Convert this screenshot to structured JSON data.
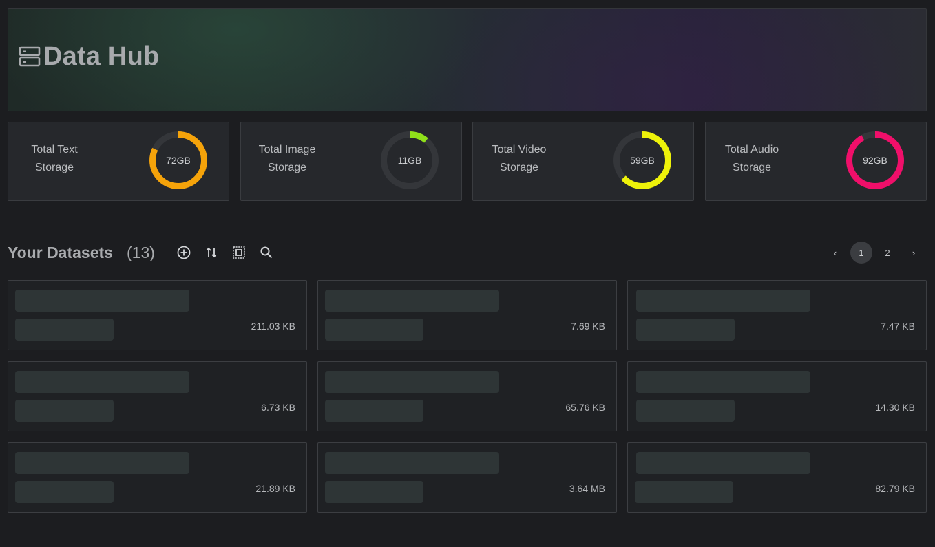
{
  "header": {
    "title": "Data Hub",
    "icon": "server-storage-icon"
  },
  "stats": [
    {
      "label_line1": "Total Text",
      "label_line2": "Storage",
      "value": "72GB",
      "fill_fraction": 0.82,
      "color": "#f5a30a"
    },
    {
      "label_line1": "Total Image",
      "label_line2": "Storage",
      "value": "11GB",
      "fill_fraction": 0.11,
      "color": "#8fe01a"
    },
    {
      "label_line1": "Total Video",
      "label_line2": "Storage",
      "value": "59GB",
      "fill_fraction": 0.63,
      "color": "#eef20a"
    },
    {
      "label_line1": "Total Audio",
      "label_line2": "Storage",
      "value": "92GB",
      "fill_fraction": 0.92,
      "color": "#f00f6a"
    }
  ],
  "datasets": {
    "title": "Your Datasets",
    "count": "(13)",
    "toolbar": {
      "add_icon": "add-circle-icon",
      "sort_icon": "sort-arrows-icon",
      "select_icon": "select-all-icon",
      "search_icon": "search-icon"
    },
    "pagination": {
      "prev": "‹",
      "pages": [
        "1",
        "2"
      ],
      "current": "1",
      "next": "›"
    },
    "items": [
      {
        "size": "211.03 KB"
      },
      {
        "size": "7.69 KB"
      },
      {
        "size": "7.47 KB"
      },
      {
        "size": "6.73 KB"
      },
      {
        "size": "65.76 KB"
      },
      {
        "size": "14.30 KB"
      },
      {
        "size": "21.89 KB"
      },
      {
        "size": "3.64 MB"
      },
      {
        "size": "82.79 KB"
      }
    ]
  },
  "colors": {
    "track": "#34363a",
    "background": "#1c1d20",
    "skeleton": "#2e3536"
  }
}
